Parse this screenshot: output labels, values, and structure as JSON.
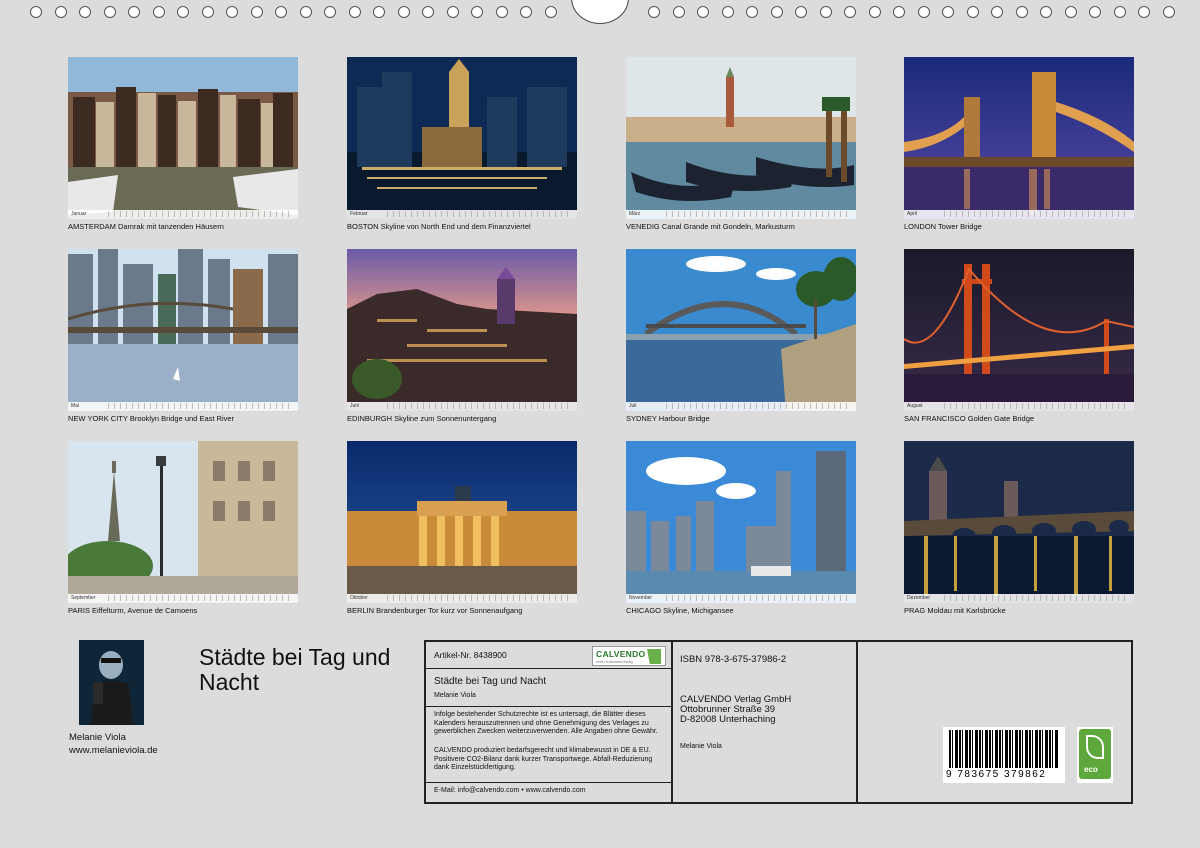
{
  "months": [
    {
      "month": "Januar",
      "caption": "AMSTERDAM Damrak mit tanzenden Häusern"
    },
    {
      "month": "Februar",
      "caption": "BOSTON Skyline von North End und dem Finanzviertel"
    },
    {
      "month": "März",
      "caption": "VENEDIG Canal Grande mit Gondeln, Markusturm"
    },
    {
      "month": "April",
      "caption": "LONDON Tower Bridge"
    },
    {
      "month": "Mai",
      "caption": "NEW YORK CITY Brooklyn Bridge und East River"
    },
    {
      "month": "Juni",
      "caption": "EDINBURGH Skyline zum Sonnenuntergang"
    },
    {
      "month": "Juli",
      "caption": "SYDNEY Harbour Bridge"
    },
    {
      "month": "August",
      "caption": "SAN FRANCISCO Golden Gate Bridge"
    },
    {
      "month": "September",
      "caption": "PARIS Eiffelturm, Avenue de Camoens"
    },
    {
      "month": "Oktober",
      "caption": "BERLIN Brandenburger Tor kurz vor Sonnenaufgang"
    },
    {
      "month": "November",
      "caption": "CHICAGO Skyline, Michigansee"
    },
    {
      "month": "Dezember",
      "caption": "PRAG Moldau mit Karlsbrücke"
    }
  ],
  "author": {
    "name": "Melanie Viola",
    "website": "www.melanieviola.de"
  },
  "calendar_title": "Städte bei Tag und Nacht",
  "infobox": {
    "article_number": "Artikel-Nr. 8438900",
    "publisher_logo": "CALVENDO",
    "publisher_logo_sub": "mein Kalendarverlag",
    "title": "Städte bei Tag und Nacht",
    "author": "Melanie Viola",
    "copyright_text": "Infolge bestehender Schutzrechte ist es untersagt, die Blätter dieses Kalenders herauszutrennen und ohne Genehmigung des Verlages zu gewerblichen Zwecken weiterzuverwenden. Alle Angaben ohne Gewähr.",
    "eco_text": "CALVENDO produziert bedarfsgerecht und klimabewusst in DE & EU. Positivere CO2-Bilanz dank kurzer Transportwege. Abfall-Reduzierung dank Einzelstückfertigung.",
    "contact": "E-Mail: info@calvendo.com • www.calvendo.com",
    "isbn": "ISBN 978-3-675-37986-2",
    "publisher_name": "CALVENDO Verlag GmbH",
    "publisher_street": "Ottobrunner Straße 39",
    "publisher_city": "D-82008 Unterhaching",
    "publisher_author": "Melanie Viola",
    "barcode_digits": "9 783675 379862",
    "eco_label": "eco"
  }
}
